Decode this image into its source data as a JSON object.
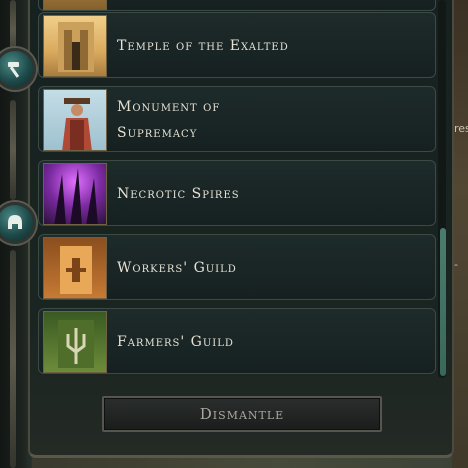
{
  "buildings": [
    {
      "name": "Temple of the Exalted",
      "thumb_colors": [
        "#e0b36a",
        "#9a6a32"
      ]
    },
    {
      "name": "Monument of Supremacy",
      "thumb_colors": [
        "#9fc6d8",
        "#b5503c"
      ]
    },
    {
      "name": "Necrotic Spires",
      "thumb_colors": [
        "#c24be0",
        "#2a1238"
      ]
    },
    {
      "name": "Workers' Guild",
      "thumb_colors": [
        "#d98a3a",
        "#6b3a14"
      ]
    },
    {
      "name": "Farmers' Guild",
      "thumb_colors": [
        "#6a8a3a",
        "#2f4418"
      ]
    }
  ],
  "actions": {
    "dismantle_label": "Dismantle"
  },
  "side_icons": [
    "hammer-icon",
    "helmet-icon"
  ],
  "right_edge_text": {
    "top": "res",
    "bottom": "-"
  },
  "colors": {
    "panel": "#17211f",
    "accent_scroll": "#4b7d6e",
    "text": "#e6e2d6"
  }
}
